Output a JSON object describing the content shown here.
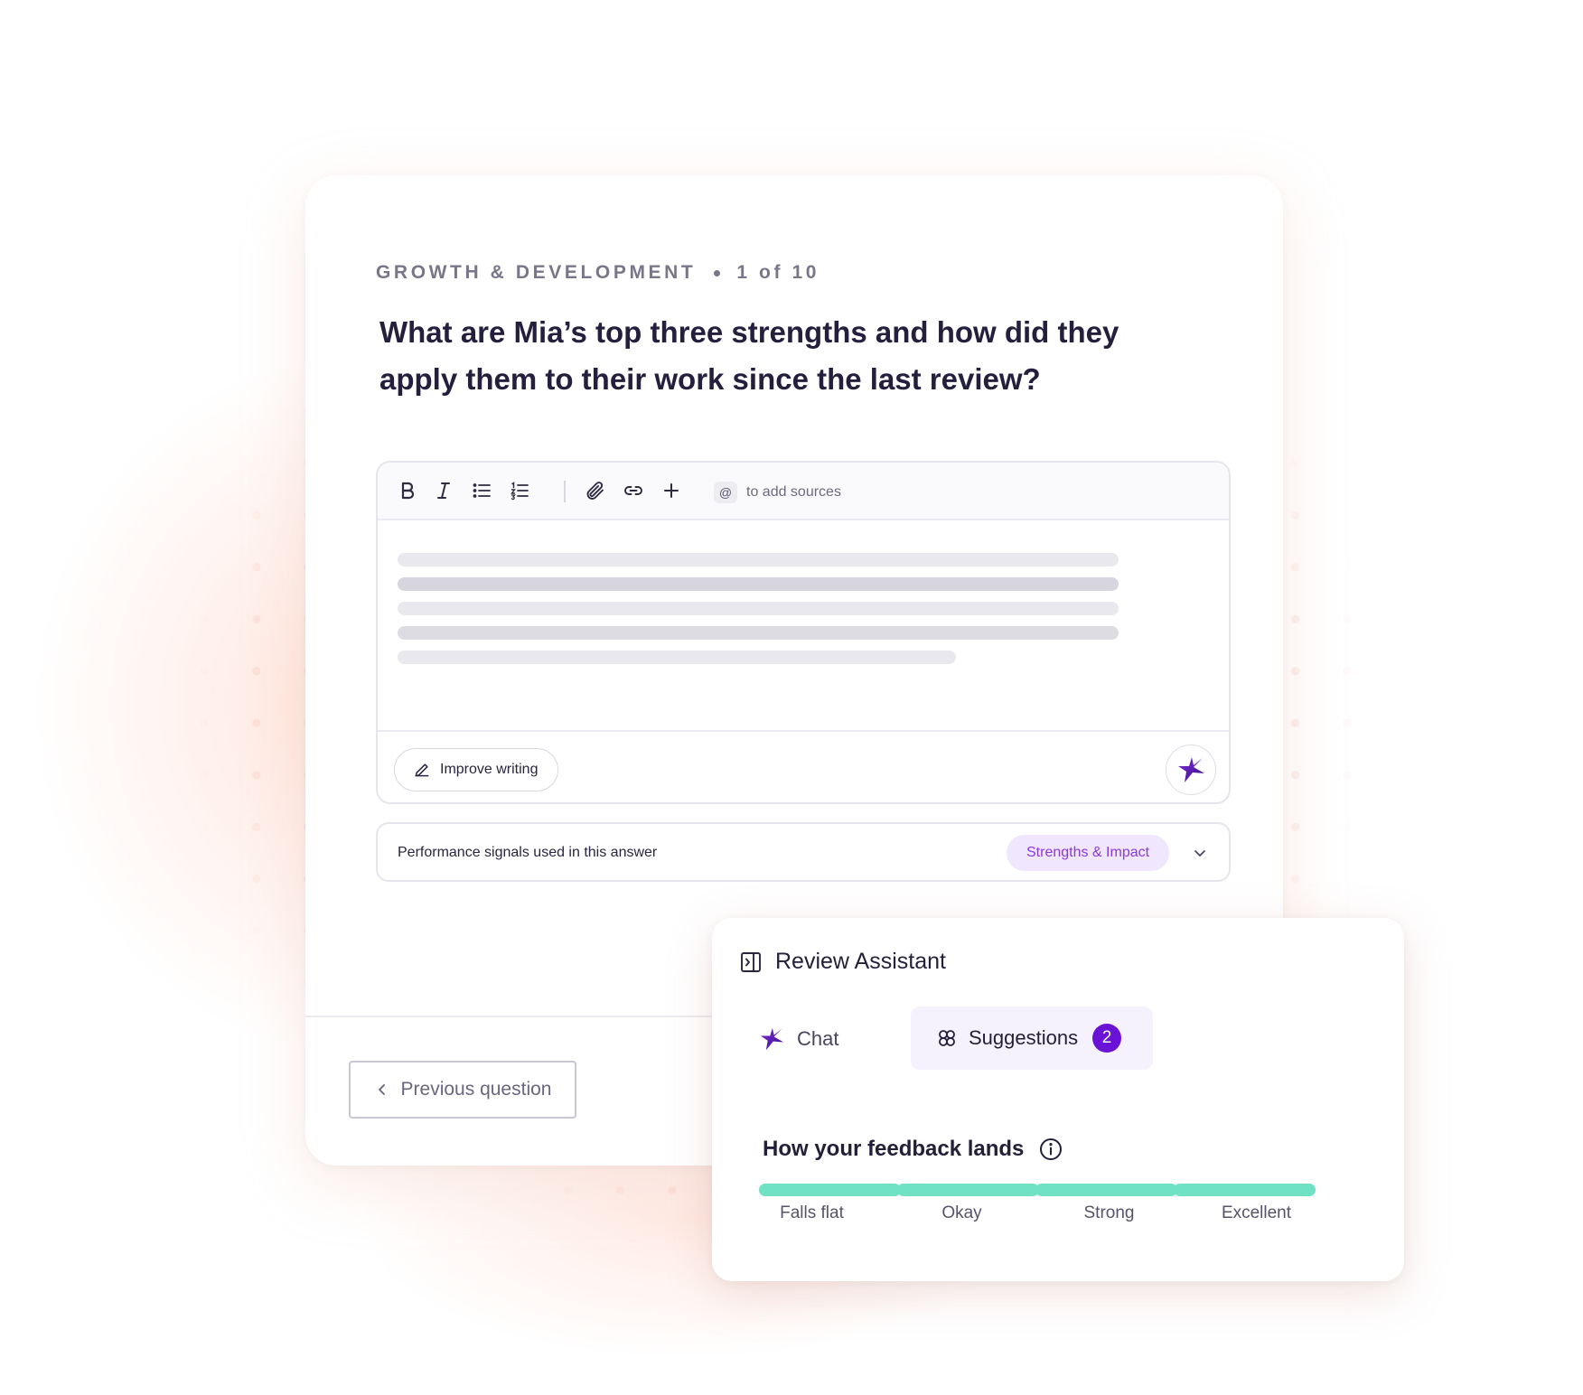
{
  "colors": {
    "accent_purple": "#6a12d6",
    "tag_bg": "#f0e6fd",
    "tag_text": "#8a3ad8",
    "meter_green": "#6ee2c2",
    "dot_color": "#f7b4a8"
  },
  "question": {
    "section": "GROWTH & DEVELOPMENT",
    "progress": "1 of 10",
    "title": "What are Mia’s top three strengths and how did they apply them to their work since the last review?"
  },
  "editor": {
    "toolbar": {
      "bold_icon": "bold-icon",
      "italic_icon": "italic-icon",
      "bullet_list_icon": "bullet-list-icon",
      "numbered_list_icon": "numbered-list-icon",
      "attach_icon": "paperclip-icon",
      "link_icon": "link-icon",
      "add_icon": "plus-icon",
      "mention_symbol": "@",
      "mention_hint": "to add sources"
    },
    "content_state": "loading-skeleton",
    "improve_writing_label": "Improve writing",
    "ai_button_icon": "sparkle-star-icon"
  },
  "signals": {
    "label": "Performance signals used in this answer",
    "tag": "Strengths & Impact"
  },
  "navigation": {
    "previous_label": "Previous question"
  },
  "assistant": {
    "title": "Review Assistant",
    "tabs": {
      "chat": "Chat",
      "suggestions": "Suggestions",
      "suggestions_count": "2"
    },
    "feedback": {
      "title": "How your feedback lands",
      "levels": [
        "Falls flat",
        "Okay",
        "Strong",
        "Excellent"
      ]
    }
  }
}
